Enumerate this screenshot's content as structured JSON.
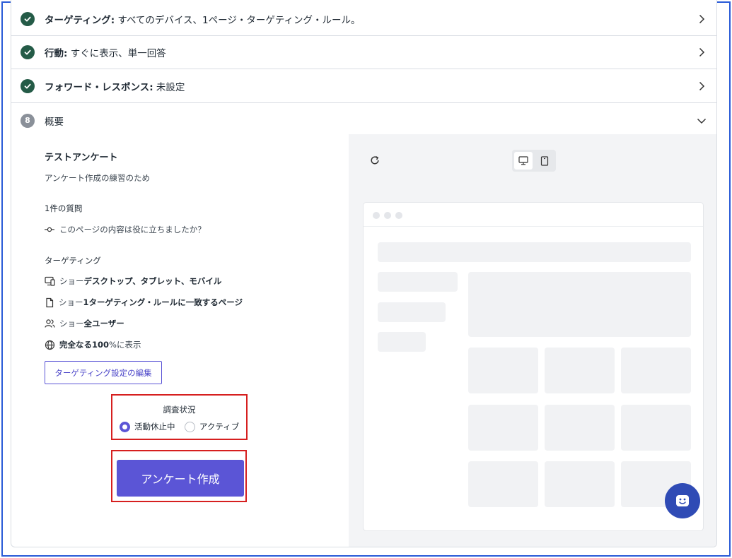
{
  "accordion": {
    "targeting": {
      "label_bold": "ターゲティング:",
      "label_rest": " すべてのデバイス、1ページ・ターゲティング・ルール。"
    },
    "behavior": {
      "label_bold": "行動:",
      "label_rest": " すぐに表示、単一回答"
    },
    "forward": {
      "label_bold": "フォワード・レスポンス:",
      "label_rest": " 未設定"
    },
    "summary": {
      "step": "8",
      "label": "概要"
    }
  },
  "summary": {
    "title": "テストアンケート",
    "description": "アンケート作成の練習のため",
    "question_count": "1件の質問",
    "question": "このページの内容は役に立ちましたか？",
    "targeting_heading": "ターゲティング",
    "targeting_lines": [
      {
        "prefix": "ショー",
        "bold": "デスクトップ、タブレット、モバイル",
        "suffix": ""
      },
      {
        "prefix": "ショー",
        "bold": "1ターゲティング・ルールに一致するページ",
        "suffix": ""
      },
      {
        "prefix": "ショー",
        "bold": "全ユーザー",
        "suffix": ""
      },
      {
        "prefix": "",
        "bold": "完全なる100",
        "suffix": " %に表示"
      }
    ],
    "edit_button": "ターゲティング設定の編集"
  },
  "status": {
    "title": "調査状況",
    "options": [
      "活動休止中",
      "アクティブ"
    ],
    "selected": "活動休止中"
  },
  "create_button": "アンケート作成",
  "colors": {
    "accent": "#5b55d6",
    "check": "#245b47",
    "highlight_border": "#d61f1f",
    "fab": "#2f4bb5"
  },
  "icons": [
    "check-icon",
    "chevron-right-icon",
    "chevron-down-icon",
    "refresh-icon",
    "desktop-icon",
    "tablet-icon",
    "smile-icon"
  ]
}
